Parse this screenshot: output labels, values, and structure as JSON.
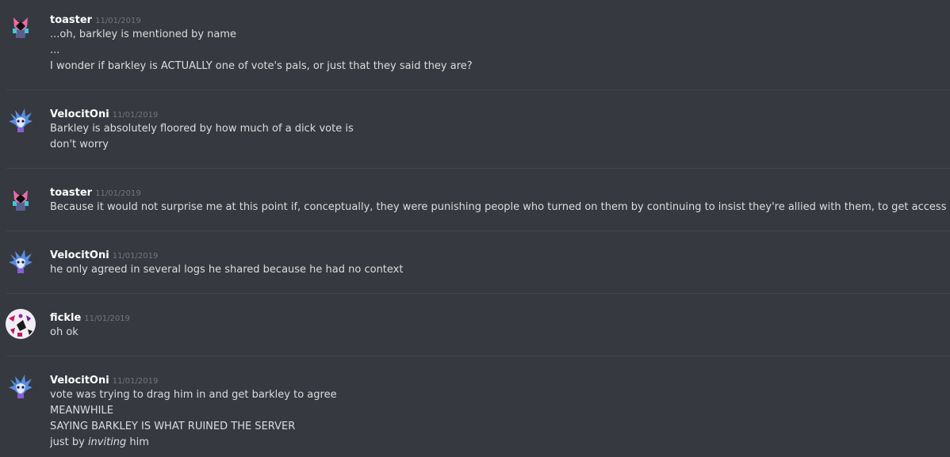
{
  "messages": [
    {
      "username": "toaster",
      "timestamp": "11/01/2019",
      "avatar": "toaster-avatar",
      "lines": [
        "...oh, barkley is mentioned by name",
        "...",
        "I wonder if barkley is ACTUALLY one of vote's pals, or just that they said they are?"
      ]
    },
    {
      "username": "VelocitOni",
      "timestamp": "11/01/2019",
      "avatar": "velocitoni-avatar",
      "lines": [
        "Barkley is absolutely floored by how much of a dick vote is",
        "don't worry"
      ]
    },
    {
      "username": "toaster",
      "timestamp": "11/01/2019",
      "avatar": "toaster-avatar",
      "lines": [
        "Because it would not surprise me at this point if, conceptually, they were punishing people who turned on them by continuing to insist they're allied with them, to get access restricted"
      ]
    },
    {
      "username": "VelocitOni",
      "timestamp": "11/01/2019",
      "avatar": "velocitoni-avatar",
      "lines": [
        "he only agreed in several logs he shared because he had no context"
      ]
    },
    {
      "username": "fickle",
      "timestamp": "11/01/2019",
      "avatar": "fickle-avatar",
      "lines": [
        "oh ok"
      ]
    },
    {
      "username": "VelocitOni",
      "timestamp": "11/01/2019",
      "avatar": "velocitoni-avatar",
      "lines": [
        "vote was trying to drag him in and get barkley to agree",
        "MEANWHILE",
        "SAYING BARKLEY IS WHAT RUINED THE SERVER"
      ],
      "last_line": {
        "prefix": "just by ",
        "emphasis": "inviting",
        "suffix": " him"
      }
    }
  ]
}
